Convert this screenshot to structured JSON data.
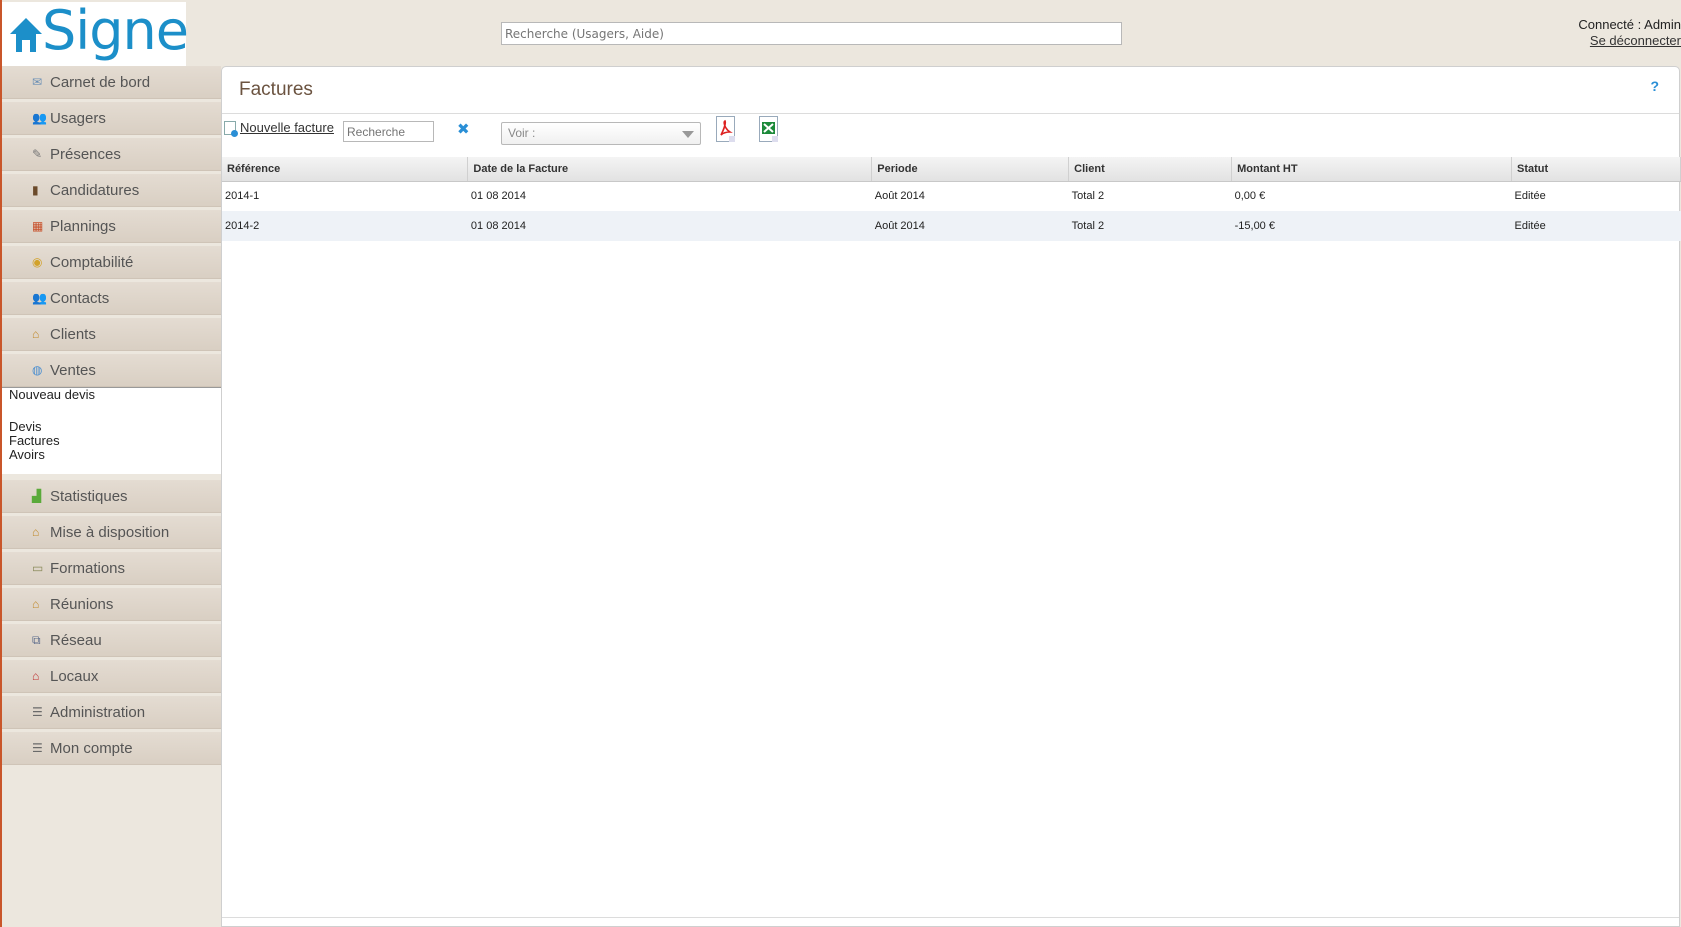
{
  "header": {
    "logo_text": "Signe",
    "search_placeholder": "Recherche (Usagers, Aide)",
    "connected_label": "Connecté : Admin",
    "logout_label": "Se déconnecter"
  },
  "sidebar": {
    "items_top": [
      {
        "label": "Carnet de bord",
        "icon": "envelope-icon"
      },
      {
        "label": "Usagers",
        "icon": "users-icon"
      },
      {
        "label": "Présences",
        "icon": "pen-icon"
      },
      {
        "label": "Candidatures",
        "icon": "book-icon"
      },
      {
        "label": "Plannings",
        "icon": "calendar-icon"
      },
      {
        "label": "Comptabilité",
        "icon": "coins-icon"
      },
      {
        "label": "Contacts",
        "icon": "users-icon"
      },
      {
        "label": "Clients",
        "icon": "house-icon"
      },
      {
        "label": "Ventes",
        "icon": "globe-icon"
      }
    ],
    "submenu": [
      "Nouveau devis",
      "Devis",
      "Factures",
      "Avoirs"
    ],
    "items_bottom": [
      {
        "label": "Statistiques",
        "icon": "bar-chart-icon"
      },
      {
        "label": "Mise à disposition",
        "icon": "house-icon"
      },
      {
        "label": "Formations",
        "icon": "picture-icon"
      },
      {
        "label": "Réunions",
        "icon": "house-icon"
      },
      {
        "label": "Réseau",
        "icon": "network-icon"
      },
      {
        "label": "Locaux",
        "icon": "building-icon"
      },
      {
        "label": "Administration",
        "icon": "list-icon"
      },
      {
        "label": "Mon compte",
        "icon": "list-icon"
      }
    ]
  },
  "main": {
    "title": "Factures",
    "help": "?",
    "new_invoice_label": "Nouvelle facture",
    "filter_placeholder": "Recherche",
    "clear_symbol": "✖",
    "voir_label": "Voir :"
  },
  "table": {
    "headers": [
      "Référence",
      "Date de la Facture",
      "Periode",
      "Client",
      "Montant HT",
      "Statut"
    ],
    "rows": [
      [
        "2014-1",
        "01 08 2014",
        "Août 2014",
        "Total 2",
        "0,00 €",
        "Editée"
      ],
      [
        "2014-2",
        "01 08 2014",
        "Août 2014",
        "Total 2",
        "-15,00 €",
        "Editée"
      ]
    ]
  },
  "colors": {
    "accent": "#1c8fc9",
    "sidebar_bg": "#e4dcd2",
    "title_color": "#6b5340"
  }
}
